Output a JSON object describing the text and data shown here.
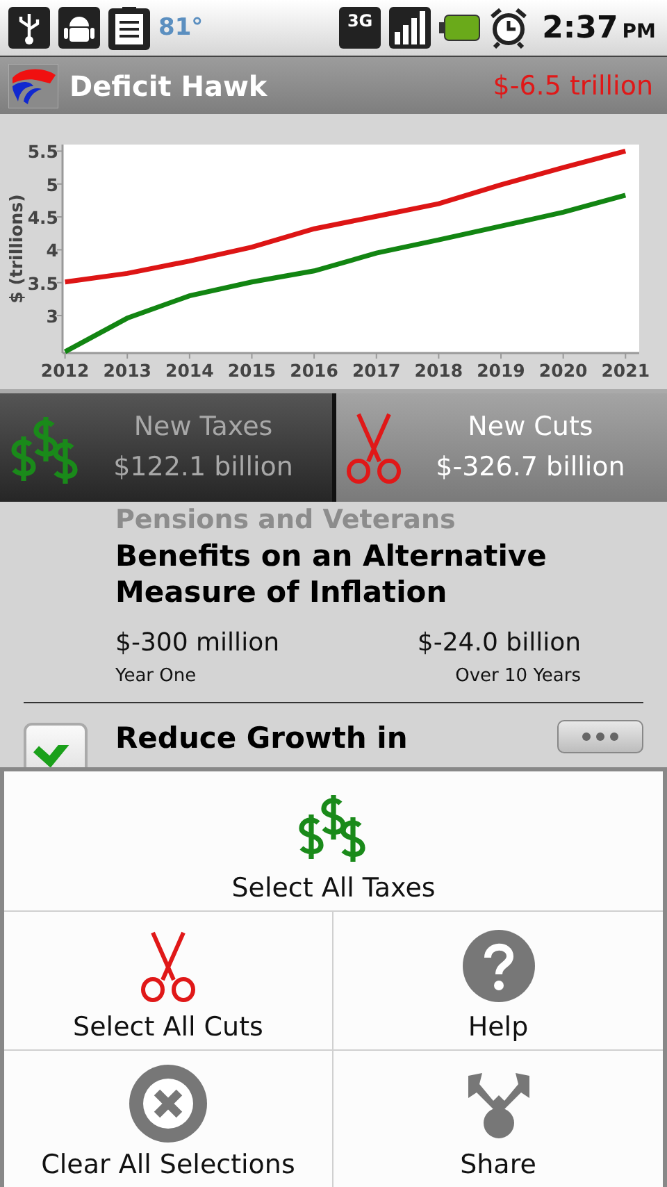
{
  "status_bar": {
    "temperature": "81°",
    "network": "3G",
    "time": "2:37",
    "meridiem": "PM"
  },
  "app_bar": {
    "title": "Deficit Hawk",
    "balance": "$-6.5 trillion"
  },
  "chart": {
    "chart_data": {
      "type": "line",
      "ylabel": "$ (trillions)",
      "x": [
        2012,
        2013,
        2014,
        2015,
        2016,
        2017,
        2018,
        2019,
        2020,
        2021
      ],
      "xlim": [
        2011.96,
        2021.22
      ],
      "xticks": [
        2012,
        2013,
        2014,
        2015,
        2016,
        2017,
        2018,
        2019,
        2020,
        2021
      ],
      "yticks": [
        3,
        3.5,
        4,
        4.5,
        5,
        5.5
      ],
      "ylim": [
        2.43,
        5.6
      ],
      "series": [
        {
          "color": "#dd1515",
          "values": [
            3.51,
            3.64,
            3.83,
            4.04,
            4.32,
            4.51,
            4.7,
            4.99,
            5.25,
            5.5
          ]
        },
        {
          "color": "#128512",
          "values": [
            2.45,
            2.96,
            3.3,
            3.51,
            3.68,
            3.95,
            4.15,
            4.36,
            4.57,
            4.83
          ]
        }
      ]
    }
  },
  "tabs": [
    {
      "kind": "taxes",
      "label": "New Taxes",
      "amount": "$122.1 billion",
      "selected": false
    },
    {
      "kind": "cuts",
      "label": "New Cuts",
      "amount": "$-326.7 billion",
      "selected": true
    }
  ],
  "items": [
    {
      "title_above": "Pensions and Veterans",
      "title": "Benefits on an Alternative Measure of Inflation",
      "year_one": "$-300 million",
      "year_one_label": "Year One",
      "ten_year": "$-24.0 billion",
      "ten_year_label": "Over 10 Years"
    },
    {
      "title": "Reduce Growth in",
      "checked": true
    }
  ],
  "menu": [
    {
      "kind": "taxes",
      "label": "Select All Taxes"
    },
    {
      "kind": "cuts",
      "label": "Select All Cuts"
    },
    {
      "kind": "help",
      "label": "Help"
    },
    {
      "kind": "clear",
      "label": "Clear All Selections"
    },
    {
      "kind": "share",
      "label": "Share"
    }
  ]
}
